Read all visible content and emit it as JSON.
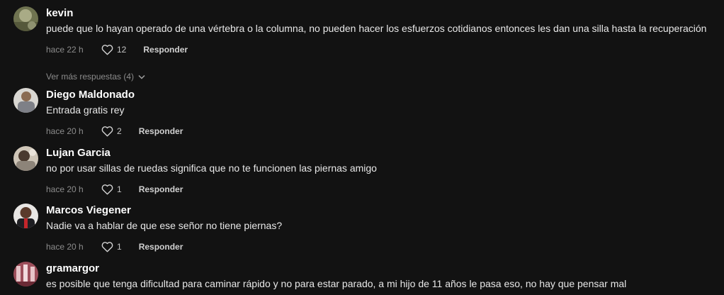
{
  "comments": [
    {
      "username": "kevin",
      "text": "puede que lo hayan operado de una vértebra o la columna, no pueden hacer los esfuerzos cotidianos entonces les dan una silla hasta la recuperación",
      "time": "hace 22 h",
      "likes": "12",
      "reply_label": "Responder"
    },
    {
      "username": "Diego Maldonado",
      "text": "Entrada gratis rey",
      "time": "hace 20 h",
      "likes": "2",
      "reply_label": "Responder"
    },
    {
      "username": "Lujan Garcia",
      "text": "no por usar sillas de ruedas significa que no te funcionen las piernas amigo",
      "time": "hace 20 h",
      "likes": "1",
      "reply_label": "Responder"
    },
    {
      "username": "Marcos Viegener",
      "text": "Nadie va a hablar de que ese señor no tiene piernas?",
      "time": "hace 20 h",
      "likes": "1",
      "reply_label": "Responder"
    },
    {
      "username": "gramargor",
      "text": "es posible que tenga dificultad para caminar rápido y no para estar parado, a mi hijo de 11 años le pasa eso, no hay que pensar mal",
      "time": "",
      "likes": "",
      "reply_label": ""
    }
  ],
  "view_more": {
    "label": "Ver más respuestas (4)"
  },
  "icons": {
    "like": "heart-outline-icon",
    "expand": "chevron-down-icon"
  },
  "colors": {
    "background": "#121212",
    "text_primary": "#ffffff",
    "text_secondary": "#8a8a8a"
  }
}
